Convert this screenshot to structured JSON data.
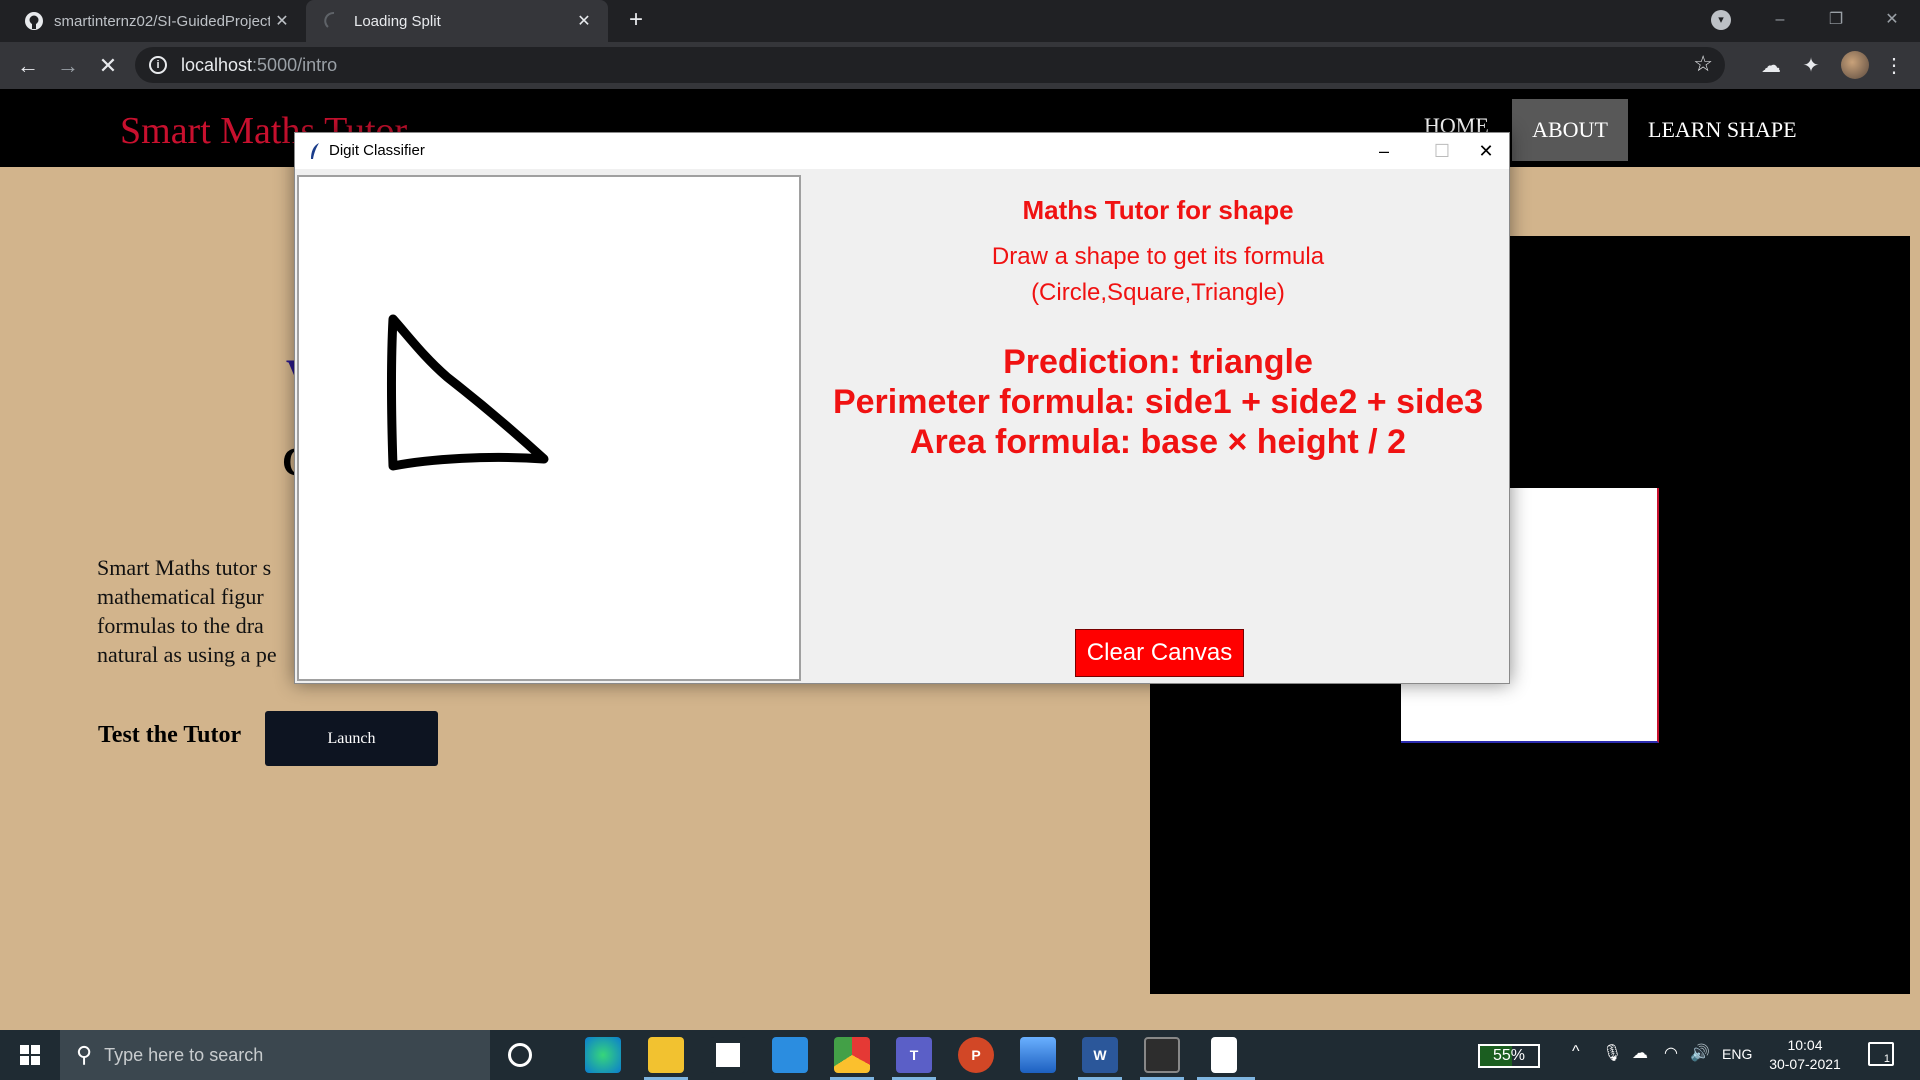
{
  "browser": {
    "tabs": [
      {
        "title": "smartinternz02/SI-GuidedProject",
        "icon": "github-icon",
        "close": "✕"
      },
      {
        "title": "Loading Split",
        "icon": "loading-spinner-icon",
        "close": "✕"
      }
    ],
    "new_tab": "+",
    "window_controls": [
      "–",
      "❐",
      "✕"
    ],
    "url_host": "localhost",
    "url_path": ":5000/intro",
    "nav_back": "←",
    "nav_forward": "→",
    "nav_stop": "✕",
    "star": "☆"
  },
  "site": {
    "brand": "Smart Maths Tutor",
    "nav": {
      "home": "HOME",
      "about": "ABOUT",
      "learn": "LEARN SHAPE"
    },
    "heading_partial_1": "V",
    "heading_partial_2": "C",
    "intro_lines": [
      "Smart Maths tutor s",
      "mathematical figur",
      "formulas to the dra",
      "natural as using a pe"
    ],
    "test_label": "Test the Tutor",
    "launch_button": "Launch"
  },
  "tk_window": {
    "title": "Digit Classifier",
    "controls": [
      "–",
      "☐",
      "✕"
    ],
    "heading": "Maths Tutor for shape",
    "subtitle_1": "Draw a shape to get its formula",
    "subtitle_2": "(Circle,Square,Triangle)",
    "prediction": "Prediction: triangle",
    "perimeter": "Perimeter formula: side1 + side2 + side3",
    "area": "Area formula: base × height / 2",
    "clear_button": "Clear Canvas"
  },
  "taskbar": {
    "search_placeholder": "Type here to search",
    "apps": [
      "edge-icon",
      "file-explorer-icon",
      "store-icon",
      "mail-icon",
      "chrome-icon",
      "teams-icon",
      "powerpoint-icon",
      "photos-icon",
      "word-icon",
      "terminal-icon",
      "notepad-icon"
    ],
    "battery": "55%",
    "language": "ENG",
    "time": "10:04",
    "date": "30-07-2021",
    "notification_count": "1"
  },
  "colors": {
    "page_bg": "#d2b48c",
    "brand_red": "#c8102e",
    "tk_red_text": "#f01212",
    "clear_button_bg": "#ff0000"
  }
}
